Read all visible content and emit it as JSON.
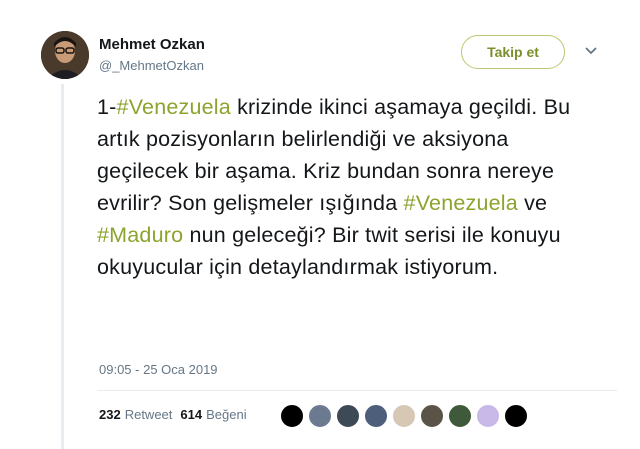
{
  "author": {
    "name": "Mehmet Ozkan",
    "handle": "@_MehmetOzkan"
  },
  "follow_label": "Takip et",
  "tweet": {
    "prefix": "1-",
    "hashtag1": "#Venezuela",
    "part1": " krizinde ikinci aşamaya geçildi. Bu artık pozisyonların belirlendiği ve aksiyona geçilecek bir aşama. Kriz bundan sonra nereye evrilir? Son gelişmeler ışığında ",
    "hashtag2": "#Venezuela",
    "part2": " ve ",
    "hashtag3": "#Maduro",
    "part3": " nun geleceği? Bir twit serisi ile konuyu okuyucular için detaylandırmak istiyorum."
  },
  "timestamp": "09:05 - 25 Oca 2019",
  "stats": {
    "retweets": "232",
    "retweet_label": "Retweet",
    "likes": "614",
    "like_label": "Beğeni"
  },
  "colors": {
    "hashtag": "#8ba42e",
    "follow_border": "#b8c96f"
  },
  "liker_avatars": [
    "#000000",
    "#6b7a8f",
    "#3d4a56",
    "#4d5f7a",
    "#d7c7b5",
    "#5a5448",
    "#3f5a3a",
    "#c8b8e8",
    "#000000"
  ]
}
